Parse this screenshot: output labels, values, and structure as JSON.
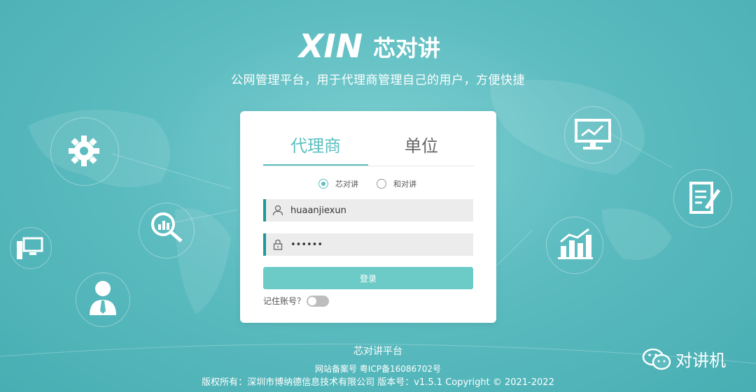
{
  "brand": {
    "logo_text": "XIN",
    "logo_cn": "芯对讲"
  },
  "subtitle": "公网管理平台，用于代理商管理自己的用户，方便快捷",
  "tabs": [
    {
      "label": "代理商",
      "active": true
    },
    {
      "label": "单位",
      "active": false
    }
  ],
  "radios": [
    {
      "label": "芯对讲",
      "checked": true
    },
    {
      "label": "和对讲",
      "checked": false
    }
  ],
  "form": {
    "username": "huaanjiexun",
    "password": "••••••",
    "login_label": "登录",
    "remember_label": "记住账号？",
    "remember_on": false
  },
  "footer": {
    "title": "芯对讲平台",
    "icp": "网站备案号 粤ICP备16086702号",
    "copyright": "版权所有：深圳市博纳德信息技术有限公司 版本号：v1.5.1 Copyright © 2021-2022"
  },
  "watermark": {
    "label": "对讲机"
  },
  "side_icons": [
    "gear-icon",
    "magnifier-chart-icon",
    "computer-icon",
    "user-tie-icon",
    "monitor-chart-icon",
    "document-edit-icon",
    "bar-chart-icon"
  ],
  "colors": {
    "accent": "#5bbfc0",
    "button": "#6ccbc7",
    "field_border": "#1e9a9e",
    "background": "#5cbcc0"
  }
}
